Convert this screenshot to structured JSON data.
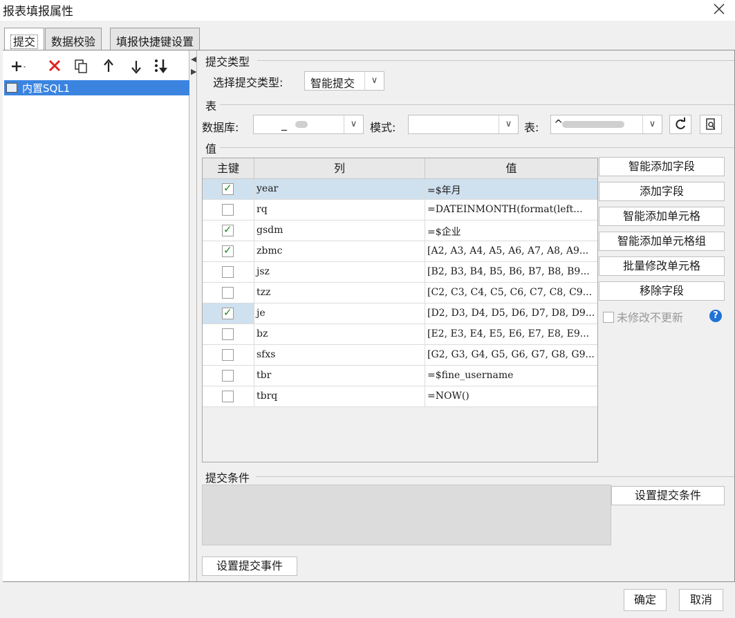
{
  "window": {
    "title": "报表填报属性"
  },
  "tabs": [
    {
      "label": "提交"
    },
    {
      "label": "数据校验"
    },
    {
      "label": "填报快捷键设置"
    }
  ],
  "toolbar": {
    "icons": [
      "plus-icon",
      "delete-icon",
      "copy-icon",
      "arrow-up-icon",
      "arrow-down-icon",
      "sort-icon"
    ]
  },
  "tree": {
    "items": [
      {
        "label": "内置SQL1"
      }
    ]
  },
  "submit_type": {
    "group_title": "提交类型",
    "label": "选择提交类型:",
    "selected": "智能提交"
  },
  "table_section": {
    "group_title": "表",
    "db_label": "数据库:",
    "db_value": "_",
    "schema_label": "模式:",
    "schema_value": "",
    "table_label": "表:",
    "table_value": "^"
  },
  "value_section": {
    "group_title": "值",
    "columns": [
      "主键",
      "列",
      "值"
    ],
    "rows": [
      {
        "pk": true,
        "column": "year",
        "value": "=$年月"
      },
      {
        "pk": false,
        "column": "rq",
        "value": "=DATEINMONTH(format(left..."
      },
      {
        "pk": true,
        "column": "gsdm",
        "value": "=$企业"
      },
      {
        "pk": true,
        "column": "zbmc",
        "value": "[A2, A3, A4, A5, A6, A7, A8, A9..."
      },
      {
        "pk": false,
        "column": "jsz",
        "value": "[B2, B3, B4, B5, B6, B7, B8, B9..."
      },
      {
        "pk": false,
        "column": "tzz",
        "value": "[C2, C3, C4, C5, C6, C7, C8, C9..."
      },
      {
        "pk": true,
        "column": "je",
        "value": "[D2, D3, D4, D5, D6, D7, D8, D9..."
      },
      {
        "pk": false,
        "column": "bz",
        "value": "[E2, E3, E4, E5, E6, E7, E8, E9..."
      },
      {
        "pk": false,
        "column": "sfxs",
        "value": "[G2, G3, G4, G5, G6, G7, G8, G9..."
      },
      {
        "pk": false,
        "column": "tbr",
        "value": "=$fine_username"
      },
      {
        "pk": false,
        "column": "tbrq",
        "value": "=NOW()"
      }
    ],
    "buttons": {
      "smart_add_field": "智能添加字段",
      "add_field": "添加字段",
      "smart_add_cell": "智能添加单元格",
      "smart_add_cell_group": "智能添加单元格组",
      "batch_modify_cell": "批量修改单元格",
      "remove_field": "移除字段"
    },
    "no_update_unmodified": "未修改不更新",
    "help": "?"
  },
  "condition_section": {
    "group_title": "提交条件",
    "set_condition_button": "设置提交条件"
  },
  "set_event_button": "设置提交事件",
  "footer": {
    "ok": "确定",
    "cancel": "取消"
  },
  "colors": {
    "selection_blue": "#3a84e0",
    "check_green": "#1e8a1e",
    "help_blue": "#1f72d6"
  }
}
